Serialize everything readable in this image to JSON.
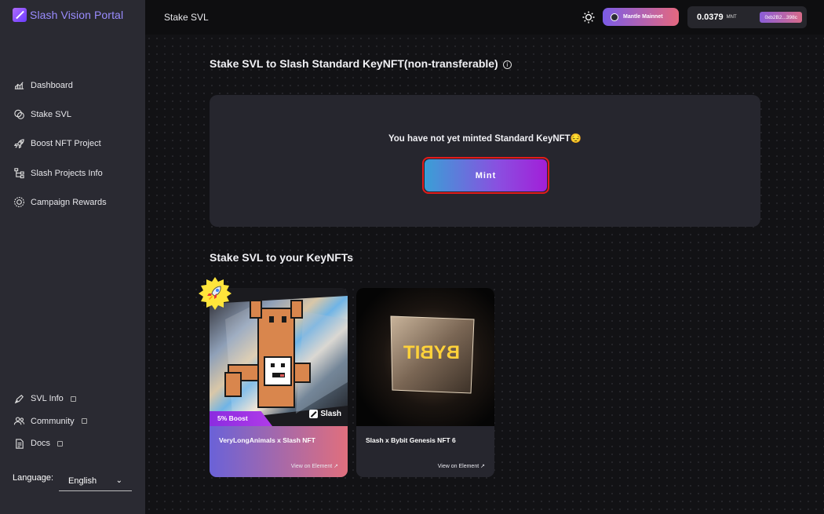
{
  "app": {
    "name": "Slash Vision Portal"
  },
  "sidebar": {
    "items": [
      {
        "label": "Dashboard",
        "icon": "chart-icon"
      },
      {
        "label": "Stake SVL",
        "icon": "coins-icon"
      },
      {
        "label": "Boost NFT Project",
        "icon": "rocket-icon"
      },
      {
        "label": "Slash Projects Info",
        "icon": "hierarchy-icon"
      },
      {
        "label": "Campaign Rewards",
        "icon": "gear-badge-icon"
      }
    ],
    "bottom": [
      {
        "label": "SVL Info",
        "icon": "pen-icon"
      },
      {
        "label": "Community",
        "icon": "people-icon"
      },
      {
        "label": "Docs",
        "icon": "document-icon"
      }
    ],
    "language_label": "Language:",
    "language_value": "English"
  },
  "header": {
    "title": "Stake SVL",
    "network": "Mantle Mainnet",
    "balance": "0.0379",
    "balance_unit": "MNT",
    "address": "0xb2B2...398c"
  },
  "main": {
    "section1_title": "Stake SVL to Slash Standard KeyNFT(non-transferable)",
    "info_glyph": "i",
    "mint_message": "You have not yet minted Standard KeyNFT😔",
    "mint_button": "Mint",
    "section2_title": "Stake SVL to your KeyNFTs",
    "nfts": [
      {
        "name": "VeryLongAnimals x Slash NFT",
        "link": "View on Element",
        "boost": "5% Boost",
        "brand": "Slash",
        "colors": {
          "footer_start": "#6a62d8",
          "footer_end": "#e06f7d"
        }
      },
      {
        "name": "Slash x Bybit Genesis NFT 6",
        "link": "View on Element",
        "cube_text": "BYBIT"
      }
    ]
  },
  "colors": {
    "accent": "#8a4fe0",
    "highlight": "#e31b1b",
    "sidebar_bg": "#2a2a32"
  }
}
